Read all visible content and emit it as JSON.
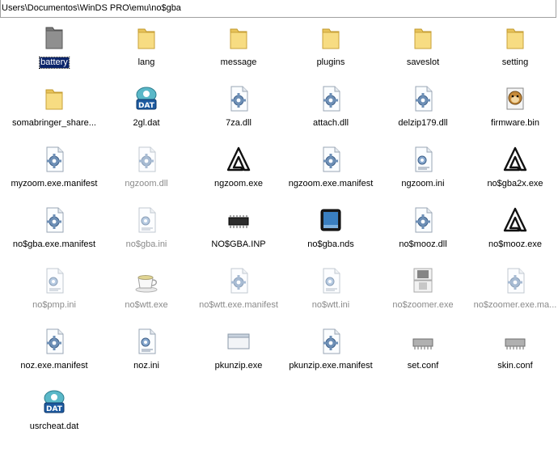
{
  "address": "Users\\Documentos\\WinDS PRO\\emu\\no$gba",
  "files": [
    {
      "name": "battery",
      "icon": "folder-gray-icon",
      "hidden": false,
      "selected": true
    },
    {
      "name": "lang",
      "icon": "folder-icon",
      "hidden": false
    },
    {
      "name": "message",
      "icon": "folder-icon",
      "hidden": false
    },
    {
      "name": "plugins",
      "icon": "folder-icon",
      "hidden": false
    },
    {
      "name": "saveslot",
      "icon": "folder-icon",
      "hidden": false
    },
    {
      "name": "setting",
      "icon": "folder-icon",
      "hidden": false
    },
    {
      "name": "somabringer_share...",
      "icon": "folder-icon",
      "hidden": false
    },
    {
      "name": "2gl.dat",
      "icon": "dat-file-icon",
      "hidden": false
    },
    {
      "name": "7za.dll",
      "icon": "settings-file-icon",
      "hidden": false
    },
    {
      "name": "attach.dll",
      "icon": "settings-file-icon",
      "hidden": false
    },
    {
      "name": "delzip179.dll",
      "icon": "settings-file-icon",
      "hidden": false
    },
    {
      "name": "firmware.bin",
      "icon": "monkey-bin-icon",
      "hidden": false
    },
    {
      "name": "myzoom.exe.manifest",
      "icon": "settings-file-icon",
      "hidden": false
    },
    {
      "name": "ngzoom.dll",
      "icon": "settings-file-icon",
      "hidden": true
    },
    {
      "name": "ngzoom.exe",
      "icon": "a-logo-icon",
      "hidden": false
    },
    {
      "name": "ngzoom.exe.manifest",
      "icon": "settings-file-icon",
      "hidden": false
    },
    {
      "name": "ngzoom.ini",
      "icon": "ini-file-icon",
      "hidden": false
    },
    {
      "name": "no$gba2x.exe",
      "icon": "a-logo-icon",
      "hidden": false
    },
    {
      "name": "no$gba.exe.manifest",
      "icon": "settings-file-icon",
      "hidden": false
    },
    {
      "name": "no$gba.ini",
      "icon": "ini-file-icon",
      "hidden": true
    },
    {
      "name": "NO$GBA.INP",
      "icon": "chip-icon",
      "hidden": false
    },
    {
      "name": "no$gba.nds",
      "icon": "nds-rom-icon",
      "hidden": false
    },
    {
      "name": "no$mooz.dll",
      "icon": "settings-file-icon",
      "hidden": false
    },
    {
      "name": "no$mooz.exe",
      "icon": "a-logo-icon",
      "hidden": false
    },
    {
      "name": "no$pmp.ini",
      "icon": "ini-file-icon",
      "hidden": true
    },
    {
      "name": "no$wtt.exe",
      "icon": "coffee-cup-icon",
      "hidden": true
    },
    {
      "name": "no$wtt.exe.manifest",
      "icon": "settings-file-icon",
      "hidden": true
    },
    {
      "name": "no$wtt.ini",
      "icon": "ini-file-icon",
      "hidden": true
    },
    {
      "name": "no$zoomer.exe",
      "icon": "ds-console-icon",
      "hidden": true
    },
    {
      "name": "no$zoomer.exe.ma...",
      "icon": "settings-file-icon",
      "hidden": true
    },
    {
      "name": "noz.exe.manifest",
      "icon": "settings-file-icon",
      "hidden": false
    },
    {
      "name": "noz.ini",
      "icon": "ini-file-icon",
      "hidden": false
    },
    {
      "name": "pkunzip.exe",
      "icon": "window-exe-icon",
      "hidden": false
    },
    {
      "name": "pkunzip.exe.manifest",
      "icon": "settings-file-icon",
      "hidden": false
    },
    {
      "name": "set.conf",
      "icon": "chip-gray-icon",
      "hidden": false
    },
    {
      "name": "skin.conf",
      "icon": "chip-gray-icon",
      "hidden": false
    },
    {
      "name": "usrcheat.dat",
      "icon": "dat-file-icon",
      "hidden": false
    }
  ]
}
